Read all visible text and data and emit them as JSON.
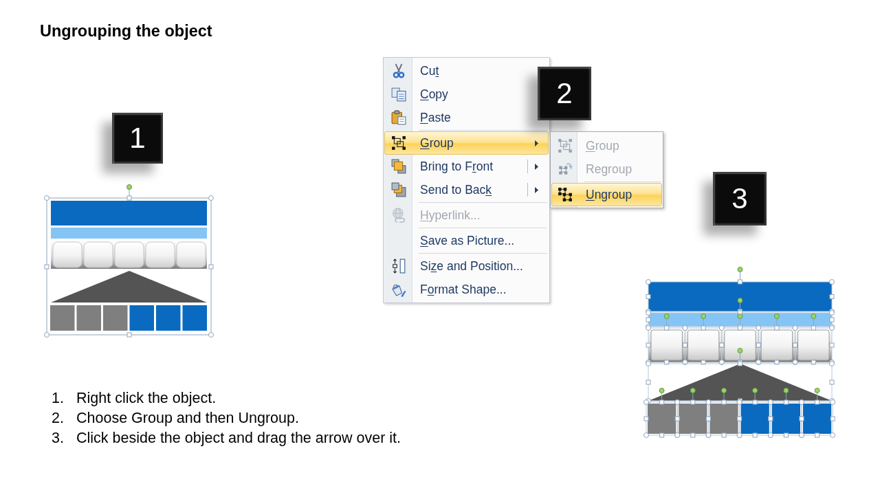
{
  "slide": {
    "title": "Ungrouping the object",
    "step_badges": [
      {
        "number": "1"
      },
      {
        "number": "2"
      },
      {
        "number": "3"
      }
    ],
    "context_menu": {
      "items": [
        {
          "label": {
            "before": "Cu",
            "key": "t"
          },
          "selected": false,
          "disabled": false,
          "submenu": false,
          "split": false,
          "separator_above": false
        },
        {
          "label": {
            "key": "C",
            "after": "opy"
          },
          "selected": false,
          "disabled": false,
          "submenu": false,
          "split": false,
          "separator_above": false
        },
        {
          "label": {
            "key": "P",
            "after": "aste"
          },
          "selected": false,
          "disabled": false,
          "submenu": false,
          "split": false,
          "separator_above": false
        },
        {
          "label": {
            "key": "G",
            "after": "roup"
          },
          "selected": true,
          "disabled": false,
          "submenu": true,
          "split": false,
          "separator_above": true
        },
        {
          "label": {
            "before": "Bring to F",
            "key": "r",
            "after": "ont"
          },
          "selected": false,
          "disabled": false,
          "submenu": true,
          "split": true,
          "separator_above": false
        },
        {
          "label": {
            "before": "Send to Bac",
            "key": "k"
          },
          "selected": false,
          "disabled": false,
          "submenu": true,
          "split": true,
          "separator_above": false
        },
        {
          "label": {
            "key": "H",
            "after": "yperlink..."
          },
          "selected": false,
          "disabled": true,
          "submenu": false,
          "split": false,
          "separator_above": true
        },
        {
          "label": {
            "key": "S",
            "after": "ave as Picture..."
          },
          "selected": false,
          "disabled": false,
          "submenu": false,
          "split": false,
          "separator_above": true
        },
        {
          "label": {
            "before": "Si",
            "key": "z",
            "after": "e and Position..."
          },
          "selected": false,
          "disabled": false,
          "submenu": false,
          "split": false,
          "separator_above": true
        },
        {
          "label": {
            "before": "F",
            "key": "o",
            "after": "rmat Shape..."
          },
          "selected": false,
          "disabled": false,
          "submenu": false,
          "split": false,
          "separator_above": false
        }
      ]
    },
    "submenu": {
      "items": [
        {
          "label": {
            "key": "G",
            "after": "roup"
          },
          "selected": false,
          "disabled": true,
          "separator_above": false
        },
        {
          "label": {
            "before": "Re",
            "key": "g",
            "after": "roup"
          },
          "selected": false,
          "disabled": true,
          "separator_above": false
        },
        {
          "label": {
            "key": "U",
            "after": "ngroup"
          },
          "selected": true,
          "disabled": false,
          "separator_above": true
        }
      ]
    },
    "instructions": [
      {
        "number": "1.",
        "text": "Right click the object."
      },
      {
        "number": "2.",
        "text": "Choose Group and then Ungroup."
      },
      {
        "number": "3.",
        "text": "Click beside the object and drag the arrow over it."
      }
    ]
  }
}
